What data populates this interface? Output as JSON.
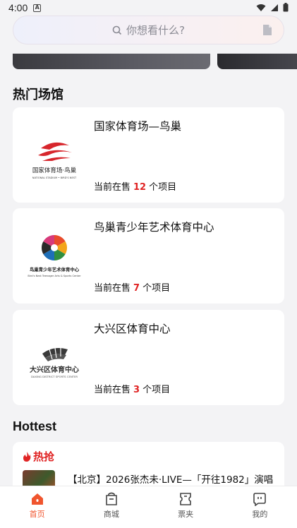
{
  "status_bar": {
    "time": "4:00",
    "notif_letter": "A"
  },
  "search": {
    "placeholder": "你想看什么?"
  },
  "sections": {
    "venues_title": "热门场馆",
    "hottest_title": "Hottest"
  },
  "venues": [
    {
      "name": "国家体育场—鸟巢",
      "count_prefix": "当前在售",
      "count": "12",
      "count_suffix": "个项目",
      "logo_text": "国家体育场·鸟巢",
      "logo_sub": "NATIONAL STADIUM • BIRD'S NEST"
    },
    {
      "name": "鸟巢青少年艺术体育中心",
      "count_prefix": "当前在售",
      "count": "7",
      "count_suffix": "个项目",
      "logo_text": "鸟巢青少年艺术体育中心",
      "logo_sub": "Bird's Nest Teenager Arts & Sports Center"
    },
    {
      "name": "大兴区体育中心",
      "count_prefix": "当前在售",
      "count": "3",
      "count_suffix": "个项目",
      "logo_text": "大兴区体育中心",
      "logo_sub": "DAXING DISTRICT SPORTS CENTER"
    }
  ],
  "hottest": {
    "tag": "热抢",
    "title": "【北京】2026张杰未·LIVE—「开往1982」演唱"
  },
  "tabs": [
    {
      "label": "首页",
      "icon": "home-icon",
      "active": true
    },
    {
      "label": "商城",
      "icon": "shop-icon",
      "active": false
    },
    {
      "label": "票夹",
      "icon": "ticket-icon",
      "active": false
    },
    {
      "label": "我的",
      "icon": "profile-icon",
      "active": false
    }
  ],
  "colors": {
    "accent": "#f0552e",
    "count_red": "#e02424"
  }
}
